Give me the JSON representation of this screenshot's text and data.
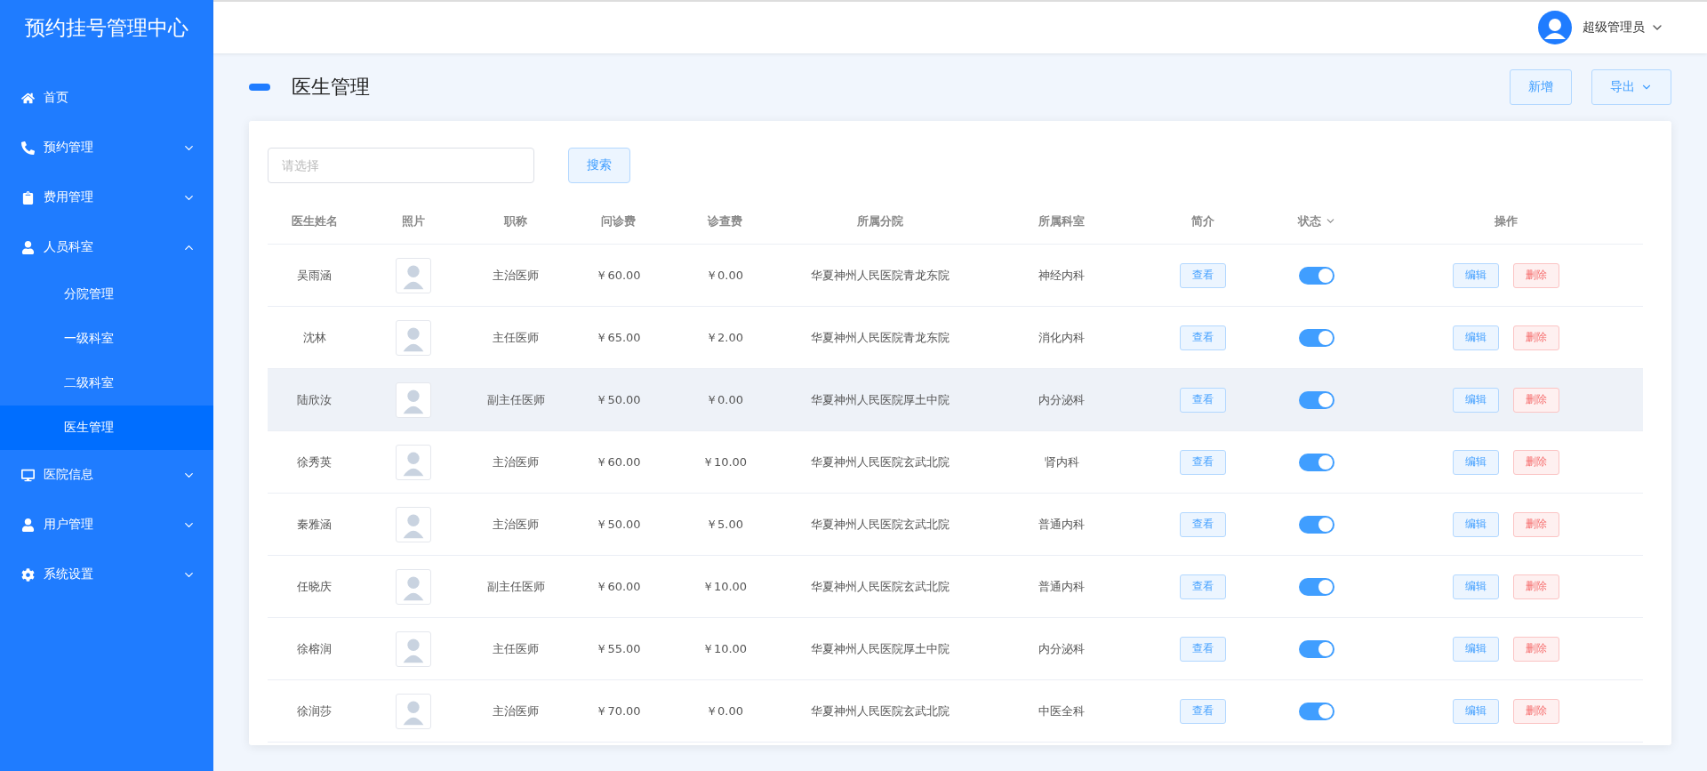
{
  "sidebar": {
    "title": "预约挂号管理中心",
    "items": [
      {
        "label": "首页",
        "kind": "link",
        "selected": false
      },
      {
        "label": "预约管理",
        "kind": "group",
        "expanded": false,
        "selected": false
      },
      {
        "label": "费用管理",
        "kind": "group",
        "expanded": false,
        "selected": false
      },
      {
        "label": "人员科室",
        "kind": "group",
        "expanded": true,
        "selected": false,
        "children": [
          {
            "label": "分院管理",
            "selected": false
          },
          {
            "label": "一级科室",
            "selected": false
          },
          {
            "label": "二级科室",
            "selected": false
          },
          {
            "label": "医生管理",
            "selected": true
          }
        ]
      },
      {
        "label": "医院信息",
        "kind": "group",
        "expanded": false,
        "selected": false
      },
      {
        "label": "用户管理",
        "kind": "group",
        "expanded": false,
        "selected": false
      },
      {
        "label": "系统设置",
        "kind": "group",
        "expanded": false,
        "selected": false
      }
    ]
  },
  "header": {
    "user": "超级管理员"
  },
  "page": {
    "title": "医生管理",
    "buttons": [
      {
        "label": "新增",
        "dropdown": false
      },
      {
        "label": "导出",
        "dropdown": true
      }
    ]
  },
  "search": {
    "placeholder": "请选择",
    "button": "搜索"
  },
  "table": {
    "columns": [
      {
        "label": "医生姓名",
        "filter": false
      },
      {
        "label": "照片",
        "filter": false
      },
      {
        "label": "职称",
        "filter": false
      },
      {
        "label": "问诊费",
        "filter": false
      },
      {
        "label": "诊查费",
        "filter": false
      },
      {
        "label": "所属分院",
        "filter": false
      },
      {
        "label": "所属科室",
        "filter": false
      },
      {
        "label": "简介",
        "filter": false
      },
      {
        "label": "状态",
        "filter": true
      },
      {
        "label": "操作",
        "filter": false
      }
    ],
    "rows": [
      {
        "name": "吴雨涵",
        "title": "主治医师",
        "consult_fee": "￥60.00",
        "exam_fee": "￥0.00",
        "branch": "华夏神州人民医院青龙东院",
        "department": "神经内科",
        "intro": "查看",
        "on": true,
        "hovered": false,
        "actions": [
          "编辑",
          "删除"
        ]
      },
      {
        "name": "沈林",
        "title": "主任医师",
        "consult_fee": "￥65.00",
        "exam_fee": "￥2.00",
        "branch": "华夏神州人民医院青龙东院",
        "department": "消化内科",
        "intro": "查看",
        "on": true,
        "hovered": false,
        "actions": [
          "编辑",
          "删除"
        ]
      },
      {
        "name": "陆欣汝",
        "title": "副主任医师",
        "consult_fee": "￥50.00",
        "exam_fee": "￥0.00",
        "branch": "华夏神州人民医院厚土中院",
        "department": "内分泌科",
        "intro": "查看",
        "on": true,
        "hovered": true,
        "actions": [
          "编辑",
          "删除"
        ]
      },
      {
        "name": "徐秀英",
        "title": "主治医师",
        "consult_fee": "￥60.00",
        "exam_fee": "￥10.00",
        "branch": "华夏神州人民医院玄武北院",
        "department": "肾内科",
        "intro": "查看",
        "on": true,
        "hovered": false,
        "actions": [
          "编辑",
          "删除"
        ]
      },
      {
        "name": "秦雅涵",
        "title": "主治医师",
        "consult_fee": "￥50.00",
        "exam_fee": "￥5.00",
        "branch": "华夏神州人民医院玄武北院",
        "department": "普通内科",
        "intro": "查看",
        "on": true,
        "hovered": false,
        "actions": [
          "编辑",
          "删除"
        ]
      },
      {
        "name": "任晓庆",
        "title": "副主任医师",
        "consult_fee": "￥60.00",
        "exam_fee": "￥10.00",
        "branch": "华夏神州人民医院玄武北院",
        "department": "普通内科",
        "intro": "查看",
        "on": true,
        "hovered": false,
        "actions": [
          "编辑",
          "删除"
        ]
      },
      {
        "name": "徐榕润",
        "title": "主任医师",
        "consult_fee": "￥55.00",
        "exam_fee": "￥10.00",
        "branch": "华夏神州人民医院厚土中院",
        "department": "内分泌科",
        "intro": "查看",
        "on": true,
        "hovered": false,
        "actions": [
          "编辑",
          "删除"
        ]
      },
      {
        "name": "徐润莎",
        "title": "主治医师",
        "consult_fee": "￥70.00",
        "exam_fee": "￥0.00",
        "branch": "华夏神州人民医院玄武北院",
        "department": "中医全科",
        "intro": "查看",
        "on": true,
        "hovered": false,
        "actions": [
          "编辑",
          "删除"
        ]
      }
    ]
  }
}
